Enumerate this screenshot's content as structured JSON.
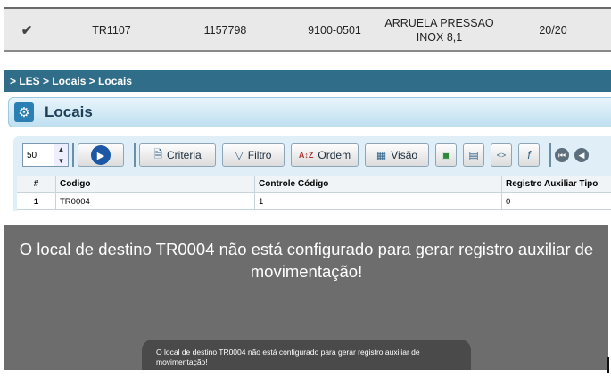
{
  "top_row": {
    "check_icon": "double-check-icon",
    "cells": [
      "TR1107",
      "1157798",
      "9100-0501",
      "ARRUELA PRESSAO INOX 8,1",
      "20/20"
    ]
  },
  "les": {
    "breadcrumb": "> LES > Locais > Locais",
    "title": "Locais",
    "toolbar": {
      "page_size": "50",
      "criteria": "Criteria",
      "filtro": "Filtro",
      "ordem": "Ordem",
      "visao": "Visão"
    },
    "grid": {
      "headers": [
        "#",
        "Codigo",
        "Controle Código",
        "Registro Auxiliar Tipo"
      ],
      "rows": [
        [
          "1",
          "TR0004",
          "1",
          "0"
        ]
      ]
    }
  },
  "modal": {
    "message": "O local de destino TR0004 não está configurado para gerar registro auxiliar de movimentação!",
    "toast": "O local de destino TR0004 não está configurado para gerar registro auxiliar de movimentação!"
  },
  "colors": {
    "breadcrumb_bg": "#2f6d88",
    "modal_bg": "#6d6d6d",
    "toast_bg": "#4a4a4a"
  }
}
